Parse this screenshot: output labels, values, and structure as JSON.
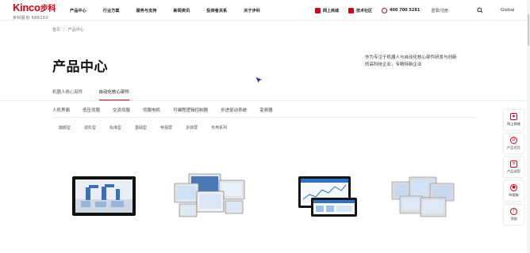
{
  "brand": {
    "name": "Kinco",
    "name_cn": "步科",
    "stock": "步科股份 688160",
    "accent": "#d7000f"
  },
  "nav": [
    {
      "label": "产品中心"
    },
    {
      "label": "行业方案"
    },
    {
      "label": "服务与支持"
    },
    {
      "label": "新闻资讯"
    },
    {
      "label": "投资者关系"
    },
    {
      "label": "关于步科"
    }
  ],
  "header_right": {
    "shop": "网上商城",
    "community": "技术社区",
    "phone": "400 700 5281",
    "login": "登录/注册",
    "search_icon": "search-icon",
    "global": "Global"
  },
  "breadcrumb": [
    "首页",
    "产品中心"
  ],
  "page_title": "产品中心",
  "intro": "作为专注于机器人与自动化核心部件研发与创新的高科技企业，专精特新企业",
  "tabs_level1": [
    {
      "label": "机器人核心部件",
      "active": false
    },
    {
      "label": "自动化核心部件",
      "active": true
    }
  ],
  "tabs_level2": [
    {
      "label": "人机界面"
    },
    {
      "label": "低压伺服"
    },
    {
      "label": "交流伺服"
    },
    {
      "label": "伺服电机"
    },
    {
      "label": "可编程逻辑控制器"
    },
    {
      "label": "步进驱动系统"
    },
    {
      "label": "变频器"
    }
  ],
  "tabs_level3": [
    {
      "label": "旗舰型"
    },
    {
      "label": "进阶型"
    },
    {
      "label": "标准型"
    },
    {
      "label": "基础型"
    },
    {
      "label": "电视屏"
    },
    {
      "label": "多转屏"
    },
    {
      "label": "专用系列"
    }
  ],
  "products": [
    {
      "icon": "hmi-panel-robot-icon"
    },
    {
      "icon": "hmi-series-group-icon"
    },
    {
      "icon": "hmi-dashboard-panels-icon"
    },
    {
      "icon": "hmi-silver-panels-icon"
    }
  ],
  "sidebar": [
    {
      "label": "网上商城",
      "icon": "cart-icon"
    },
    {
      "label": "产品对比",
      "icon": "compare-icon"
    },
    {
      "label": "产品选型",
      "icon": "select-icon"
    },
    {
      "label": "AI客服",
      "icon": "ai-icon"
    },
    {
      "label": "顶部",
      "icon": "arrow-up-icon"
    }
  ]
}
